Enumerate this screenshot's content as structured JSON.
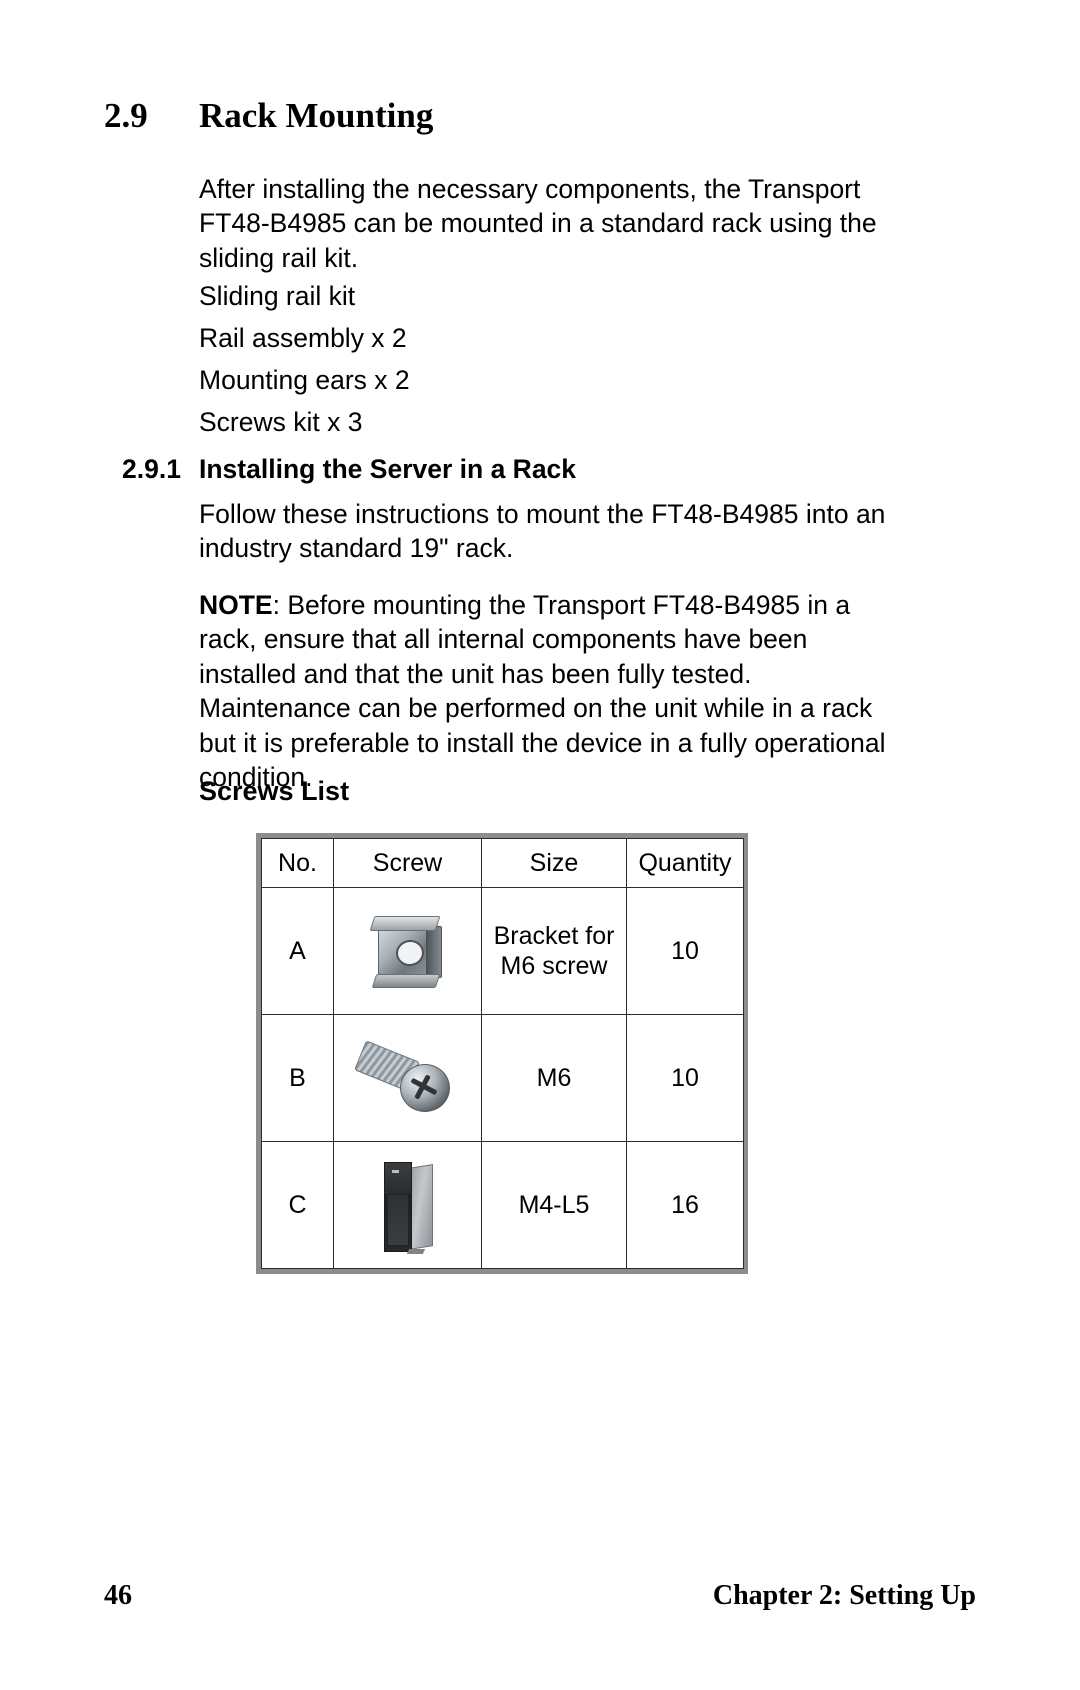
{
  "document": {
    "section": {
      "number": "2.9",
      "title": "Rack Mounting"
    },
    "paragraphs": {
      "intro": "After installing the necessary components, the Transport FT48-B4985 can be mounted in a standard rack using the sliding rail kit.",
      "kit_items": [
        "Sliding rail kit",
        "Rail assembly x 2",
        "Mounting ears x 2",
        "Screws kit x 3"
      ]
    },
    "subsection": {
      "number": "2.9.1",
      "title": "Installing the Server in a Rack",
      "body": "Follow these instructions to mount the FT48-B4985 into an industry standard 19\" rack.",
      "note_label": "NOTE",
      "note_body": ": Before mounting the Transport FT48-B4985 in a rack, ensure that all internal components have been installed and that the unit has been fully tested. Maintenance can be performed on the unit while in a rack but it is preferable to install the device in a fully operational condition."
    },
    "screws_list": {
      "heading": "Screws List",
      "columns": [
        "No.",
        "Screw",
        "Size",
        "Quantity"
      ],
      "rows": [
        {
          "no": "A",
          "screw_image": "cage-nut-bracket-image",
          "size": "Bracket for M6 screw",
          "size_line1": "Bracket for",
          "size_line2": "M6 screw",
          "quantity": "10"
        },
        {
          "no": "B",
          "screw_image": "pan-head-screw-image",
          "size": "M6",
          "size_line1": "M6",
          "size_line2": "",
          "quantity": "10"
        },
        {
          "no": "C",
          "screw_image": "tower-chassis-image",
          "size": "M4-L5",
          "size_line1": "M4-L5",
          "size_line2": "",
          "quantity": "16"
        }
      ]
    },
    "footer": {
      "page_number": "46",
      "chapter": "Chapter 2: Setting Up"
    },
    "colors": {
      "text": "#000000",
      "page_background": "#ffffff",
      "table_outer_border": "#8c8c8c",
      "table_inner_border": "#2b2b2b"
    }
  }
}
